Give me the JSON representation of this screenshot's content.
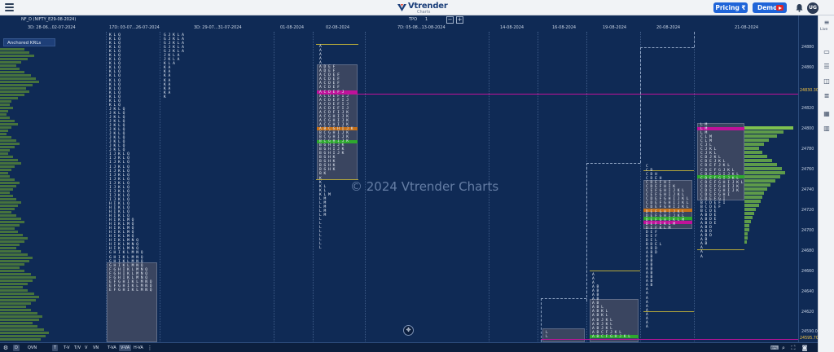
{
  "app": {
    "logo_text": "Vtrender",
    "logo_sub": "Charts",
    "pricing_label": "Pricing ₹",
    "demo_label": "Demo",
    "avatar_initials": "UG",
    "watermark": "© 2024 Vtrender Charts"
  },
  "chart": {
    "symbol": "NF_D (NIFTY_E29-08-2024)",
    "tpo_label": "TPO",
    "tpo_value": "1",
    "minus_label": "−",
    "plus_label": "+",
    "anchored_label": "Anchored KRLs",
    "periods": [
      "3D: 28-06...02-07-2024",
      "17D: 03-07...26-07-2024",
      "3D: 29-07...31-07-2024",
      "01-08-2024",
      "02-08-2024",
      "7D: 05-08...13-08-2024",
      "14-08-2024",
      "16-08-2024",
      "19-08-2024",
      "20-08-2024",
      "21-08-2024"
    ],
    "prices": [
      "24880",
      "24860",
      "24840",
      "24820",
      "24800",
      "24780",
      "24760",
      "24740",
      "24720",
      "24700",
      "24680",
      "24660",
      "24640",
      "24620",
      "24600"
    ],
    "price_tag_top": "24830.30",
    "price_tag_bottom": "24595.70",
    "price_tag_bottom2": "24590.00",
    "colors": {
      "background": "#0f2a55",
      "poc_line": "#c0129a",
      "value_area": "#e8d44d",
      "green": "#2ea82e",
      "orange": "#c4701a",
      "magenta": "#c0129a"
    }
  },
  "tpo": {
    "col_17d": "K L Q\nK L Q\nK L Q\nK L Q\nK L Q\nK L Q\nK L Q\nK L Q\nK L Q\nK L Q\nK L Q\nK L Q\nK L Q\nK L Q\nK L Q\nK L Q\nK L Q\nK L Q\nJ K L Q\nJ K L Q\nJ K L Q\nJ K L Q\nJ K L Q\nJ K L Q\nJ K L Q\nJ K L Q\nJ K L Q\nJ K L Q\nJ K L Q\nI J K L Q\nI J K L Q\nI J K L Q\nI J K L Q\nI J K L Q\nI J K L Q\nI J K L Q\nI J K L Q\nI J K L Q\nI J K L Q\nI J K L Q\nI J K L Q\nH I K L Q\nH I K L Q\nH I K L Q\nH I K L Q\nH I K L M Q\nH I K L M Q\nH I K L M Q\nH I K L M Q\nH I K L M Q\nH I K L M N Q\nH I K L M N Q\nH I K L M N Q\nG H I K L M N Q\nG H I K L M N Q\nG H I K L M N Q\nG H I K L M N Q\nF G H I K L M N Q\nF G H I K L M N Q\nF G H I K L M N Q\nE F G H I K L M N Q\nE F G H I K L M N Q\nE F G H I K L M N Q",
    "col_3d": "G J K L A\nG J K L A\nG J K L A\nG J K L A\nG J K L A\nJ K L A\nJ K L A\nK L A\nK A\nK A\nK A\nK A\nK A\nK A\nK A\nK",
    "col_0208": "A\nA\nA\nA\nA\nA D E F\nA D E F\nA C D E F\nA C D E F\nA C D E F\nA C D E F\nA C D E F J\nA C D E F I J\nA C D E F I J\nA C D E F I J\nA C D E F I J\nA C D F I J K\nA C G H I J K\nA C G H I J K\nA C G H I J K\nA B C G H I J K\nB C G H I J K\nB C G H I J K\nB C G H I J K\nB G H I J K\nB G H I J K\nB G H I J K\nB G H K\nB G H K\nB G H K\nB G H K\nB K\nK\nK\nK L\nK L\nK L M\nL M\nL M\nL M\nL M\nL M\nL\nL\nL\nL\nL\nL\nL\nL",
    "col_1908": "A\nA\nA\nA B\nA B\nA B\nA B\nA B\nA B L\nA B K L\nA B K L\nA B J K L\nA B J K L\nA B J K L\nA B C F J K L\nA B C F G H J K L",
    "col_2008": "C\nC D\nC D H\nC D E H\nC D E F H I\nC D E F H I K\nC E F G H I J K L\nC E F G H I J K L\nC D E F G H I J K L\nC D E F G H I J K L\nC D E F G H I J K L\nD E F G H I J K L\nD E F G H I J K L\nD E F G H I K L M\nD E F I K L M\nD E F K L M\nD E F\nD E F\nD E L\nB D E L\nA B D\nA B D\nA B\nA B\nA B\nA B\nA B\nA B\nA B\nA B\nA\nA\nA\nA\nA\nA\nA\nA\nA\nA",
    "col_2108": "L M\nL M\nL M\nC L M\nC L M\nC J L\nC J K L\nC J K L\nC D J K L\nC D E J K L\nC D E F J K L\nC D E F G J K L\nC D E F G I J K L\nC D E F G I J K L\nC D E F G H I J K L\nC D E F G H I J K\nC D E F G H I J K\nC D E F G H I\nC D E F G I\nB C D E F I\nB C D E F\nB C D E\nA B D E\nA B D E\nA B D E\nA B D\nA B D\nA B D\nA B\nA B\nA\nA\nA"
  },
  "bottom": {
    "d_label": "D",
    "qvn_label": "QVN",
    "t_label": "T",
    "tv_label": "T-V",
    "tpv_label": "T/V",
    "v_label": "V",
    "vn_label": "VN",
    "tva_label": "T-VA",
    "vva_label": "V-VA",
    "hva_label": "H-VA"
  },
  "sidebar": {
    "label": "Live"
  }
}
